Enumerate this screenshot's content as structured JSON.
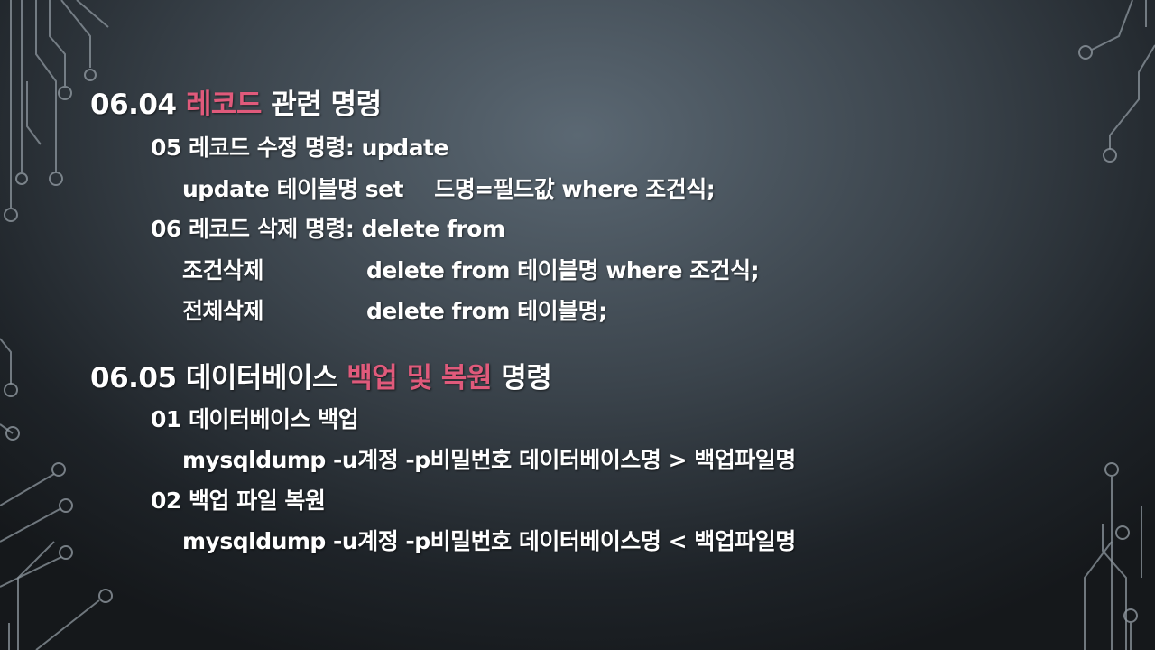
{
  "section1": {
    "number": "06.04",
    "accent": "레코드",
    "rest": "관련 명령",
    "item5": {
      "title": "05 레코드 수정 명령: update",
      "syntax_a": "update 테이블명 set",
      "syntax_b": "드명=필드값 where 조건식;"
    },
    "item6": {
      "title": "06 레코드 삭제 명령: delete from",
      "rows": [
        {
          "label": "조건삭제",
          "syntax": "delete from 테이블명 where 조건식;"
        },
        {
          "label": "전체삭제",
          "syntax": "delete from 테이블명;"
        }
      ]
    }
  },
  "section2": {
    "number": "06.05",
    "pre": "데이터베이스",
    "accent": "백업 및 복원",
    "rest": "명령",
    "item1": {
      "title": "01 데이터베이스 백업",
      "syntax": "mysqldump -u계정 -p비밀번호 데이터베이스명 > 백업파일명"
    },
    "item2": {
      "title": "02 백업 파일 복원",
      "syntax": "mysqldump -u계정 -p비밀번호 데이터베이스명 < 백업파일명"
    }
  },
  "colors": {
    "accent": "#e05a7b",
    "text": "#ffffff",
    "circuit": "#8e979f"
  }
}
